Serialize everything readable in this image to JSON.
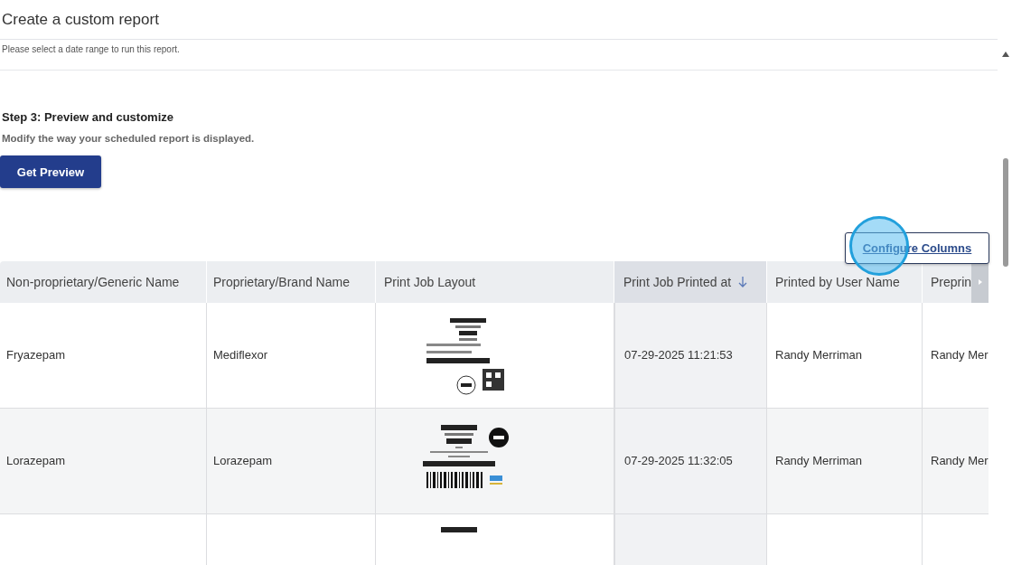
{
  "page_title": "Create a custom report",
  "date_hint": "Please select a date range to run this report.",
  "step": {
    "heading": "Step 3: Preview and customize",
    "description": "Modify the way your scheduled report is displayed.",
    "button": "Get Preview"
  },
  "configure_button": "Configure Columns",
  "table": {
    "columns": [
      {
        "label": "Non-proprietary/Generic Name",
        "sorted": false
      },
      {
        "label": "Proprietary/Brand Name",
        "sorted": false
      },
      {
        "label": "Print Job Layout",
        "sorted": false
      },
      {
        "label": "Print Job Printed at",
        "sorted": true
      },
      {
        "label": "Printed by User Name",
        "sorted": false
      },
      {
        "label": "Preprin",
        "sorted": false
      }
    ],
    "rows": [
      {
        "cells": [
          "Fryazepam",
          "Mediflexor",
          null,
          "07-29-2025 11:21:53",
          "Randy Merriman",
          "Randy Mer"
        ],
        "highlighted": false,
        "kind": "qr"
      },
      {
        "cells": [
          "Lorazepam",
          "Lorazepam",
          null,
          "07-29-2025 11:32:05",
          "Randy Merriman",
          "Randy Mer"
        ],
        "highlighted": true,
        "kind": "barcode"
      },
      {
        "cells": [
          null,
          null,
          null,
          null,
          null,
          null
        ],
        "highlighted": false,
        "kind": "partial"
      }
    ]
  }
}
